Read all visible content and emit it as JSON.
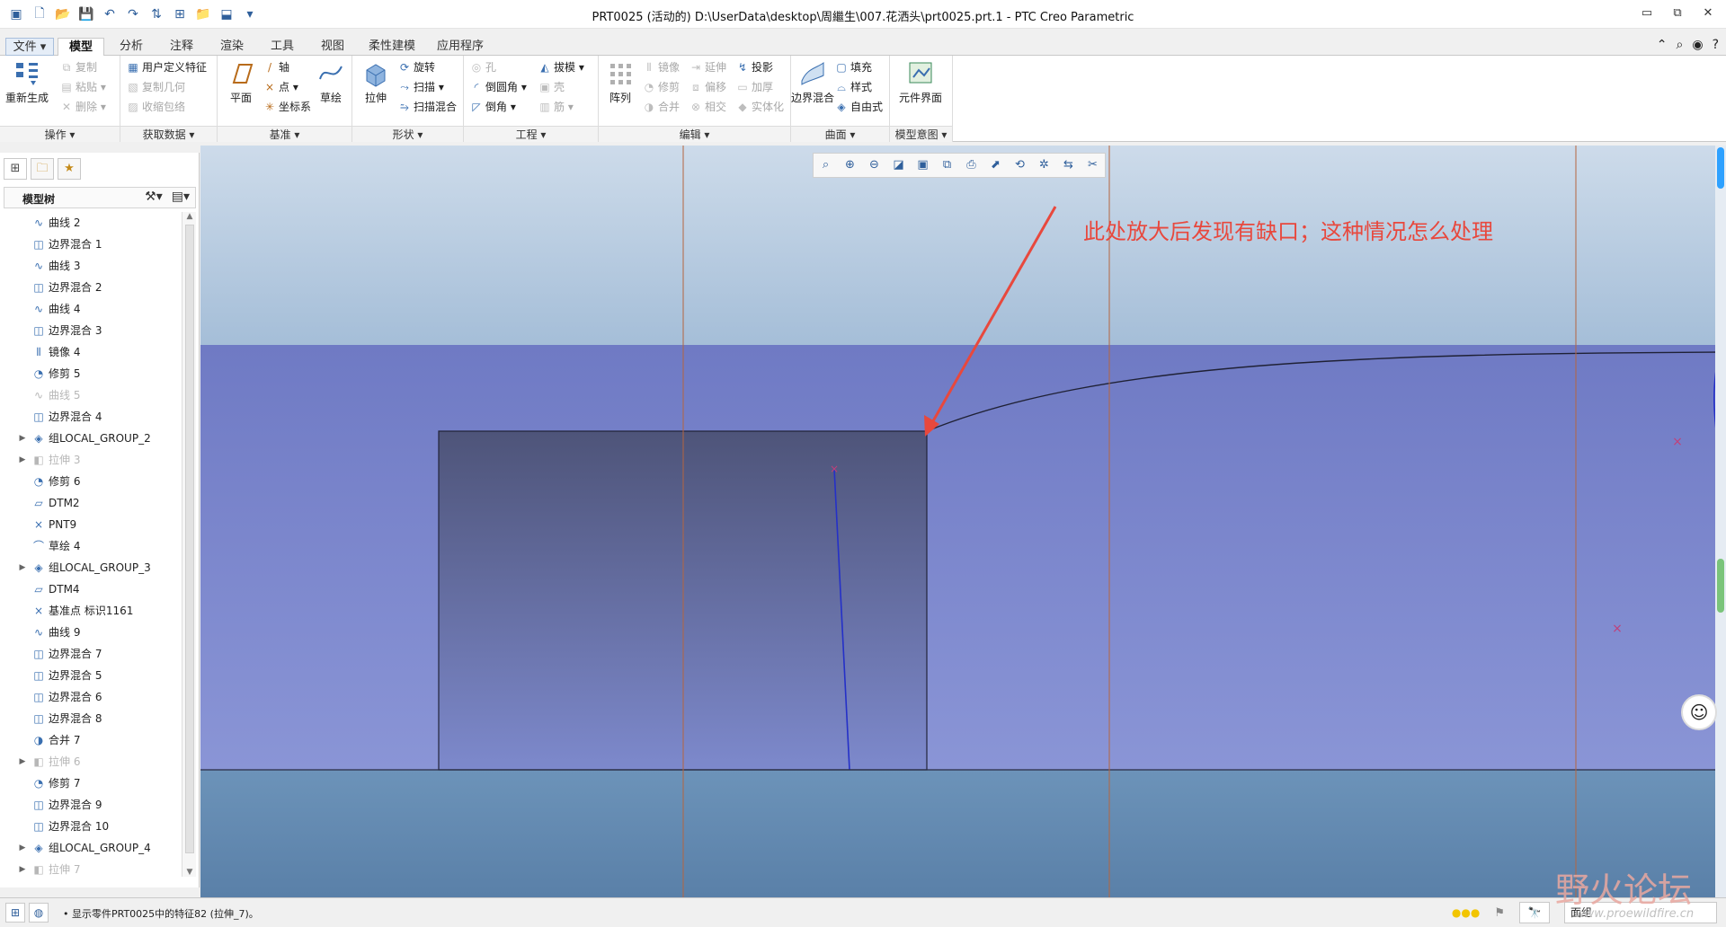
{
  "window": {
    "title": "PRT0025 (活动的) D:\\UserData\\desktop\\周繼生\\007.花洒头\\prt0025.prt.1 - PTC Creo Parametric",
    "controls": [
      "▭",
      "⧉",
      "✕"
    ]
  },
  "quick_access": [
    "▣",
    "🗋",
    "📂",
    "💾",
    "↶",
    "↷",
    "⇅",
    "⊞",
    "📁",
    "⬓",
    "▾"
  ],
  "tabs": [
    {
      "label": "文件 ▾",
      "id": "file"
    },
    {
      "label": "模型",
      "active": true
    },
    {
      "label": "分析"
    },
    {
      "label": "注释"
    },
    {
      "label": "渲染"
    },
    {
      "label": "工具"
    },
    {
      "label": "视图"
    },
    {
      "label": "柔性建模"
    },
    {
      "label": "应用程序"
    }
  ],
  "ribbon": {
    "operations": {
      "label": "操作 ▾",
      "regen": "重新生成",
      "copy": "复制",
      "paste": "粘贴",
      "delete": "删除"
    },
    "get_data": {
      "label": "获取数据 ▾",
      "udf": "用户定义特征",
      "copy_geom": "复制几何",
      "shrinkwrap": "收缩包络"
    },
    "datum": {
      "label": "基准 ▾",
      "plane": "平面",
      "axis": "轴",
      "point": "点",
      "csys": "坐标系",
      "sketch": "草绘"
    },
    "shapes": {
      "label": "形状 ▾",
      "extrude": "拉伸",
      "revolve": "旋转",
      "sweep": "扫描",
      "swept_blend": "扫描混合"
    },
    "engineering": {
      "label": "工程 ▾",
      "hole": "孔",
      "round": "倒圆角",
      "chamfer": "倒角",
      "draft": "拔模",
      "shell": "壳",
      "rib": "筋"
    },
    "editing": {
      "label": "编辑 ▾",
      "pattern": "阵列",
      "mirror": "镜像",
      "trim": "修剪",
      "merge": "合并",
      "extend": "延伸",
      "offset": "偏移",
      "intersect": "相交",
      "project": "投影",
      "thicken": "加厚",
      "solidify": "实体化"
    },
    "surfaces": {
      "label": "曲面 ▾",
      "boundary": "边界混合",
      "fill": "填充",
      "style": "样式",
      "freestyle": "自由式"
    },
    "model_intent": {
      "label": "模型意图 ▾",
      "component_interface": "元件界面"
    }
  },
  "model_tree": {
    "title": "模型树",
    "items": [
      {
        "label": "曲线 2",
        "icon": "∿",
        "expand": ""
      },
      {
        "label": "边界混合 1",
        "icon": "◫",
        "expand": ""
      },
      {
        "label": "曲线 3",
        "icon": "∿",
        "expand": ""
      },
      {
        "label": "边界混合 2",
        "icon": "◫",
        "expand": ""
      },
      {
        "label": "曲线 4",
        "icon": "∿",
        "expand": ""
      },
      {
        "label": "边界混合 3",
        "icon": "◫",
        "expand": ""
      },
      {
        "label": "镜像 4",
        "icon": "⫴",
        "expand": ""
      },
      {
        "label": "修剪 5",
        "icon": "◔",
        "expand": ""
      },
      {
        "label": "曲线 5",
        "icon": "∿",
        "expand": "",
        "dim": true
      },
      {
        "label": "边界混合 4",
        "icon": "◫",
        "expand": ""
      },
      {
        "label": "组LOCAL_GROUP_2",
        "icon": "◈",
        "expand": "▶"
      },
      {
        "label": "拉伸 3",
        "icon": "◧",
        "expand": "▶",
        "dim": true
      },
      {
        "label": "修剪 6",
        "icon": "◔",
        "expand": ""
      },
      {
        "label": "DTM2",
        "icon": "▱",
        "expand": ""
      },
      {
        "label": "PNT9",
        "icon": "×",
        "expand": ""
      },
      {
        "label": "草绘 4",
        "icon": "⌒",
        "expand": ""
      },
      {
        "label": "组LOCAL_GROUP_3",
        "icon": "◈",
        "expand": "▶"
      },
      {
        "label": "DTM4",
        "icon": "▱",
        "expand": ""
      },
      {
        "label": "基准点 标识1161",
        "icon": "×",
        "expand": ""
      },
      {
        "label": "曲线 9",
        "icon": "∿",
        "expand": ""
      },
      {
        "label": "边界混合 7",
        "icon": "◫",
        "expand": ""
      },
      {
        "label": "边界混合 5",
        "icon": "◫",
        "expand": ""
      },
      {
        "label": "边界混合 6",
        "icon": "◫",
        "expand": ""
      },
      {
        "label": "边界混合 8",
        "icon": "◫",
        "expand": ""
      },
      {
        "label": "合并 7",
        "icon": "◑",
        "expand": ""
      },
      {
        "label": "拉伸 6",
        "icon": "◧",
        "expand": "▶",
        "dim": true
      },
      {
        "label": "修剪 7",
        "icon": "◔",
        "expand": ""
      },
      {
        "label": "边界混合 9",
        "icon": "◫",
        "expand": ""
      },
      {
        "label": "边界混合 10",
        "icon": "◫",
        "expand": ""
      },
      {
        "label": "组LOCAL_GROUP_4",
        "icon": "◈",
        "expand": "▶"
      },
      {
        "label": "拉伸 7",
        "icon": "◧",
        "expand": "▶",
        "dim": true
      }
    ]
  },
  "view_toolbar": [
    "⌕",
    "⊕",
    "⊖",
    "◪",
    "▣",
    "⧉",
    "⎙",
    "⬈",
    "⟲",
    "✲",
    "⇆",
    "✂"
  ],
  "annotation": "此处放大后发现有缺口；这种情况怎么处理",
  "status": {
    "message": "• 显示零件PRT0025中的特征82 (拉伸_7)。",
    "filter": "面组",
    "find_icon": "🔭",
    "lights": "●●●"
  },
  "watermark": {
    "text": "野火论坛",
    "url": "www.proewildfire.cn"
  },
  "colors": {
    "sky_top": "#c9d9e8",
    "sky_bottom": "#a6bfd8",
    "surface": "#7b86cc",
    "dark_face": "#575c86",
    "floor": "#6a8fb2",
    "annotation": "#e8483d"
  }
}
